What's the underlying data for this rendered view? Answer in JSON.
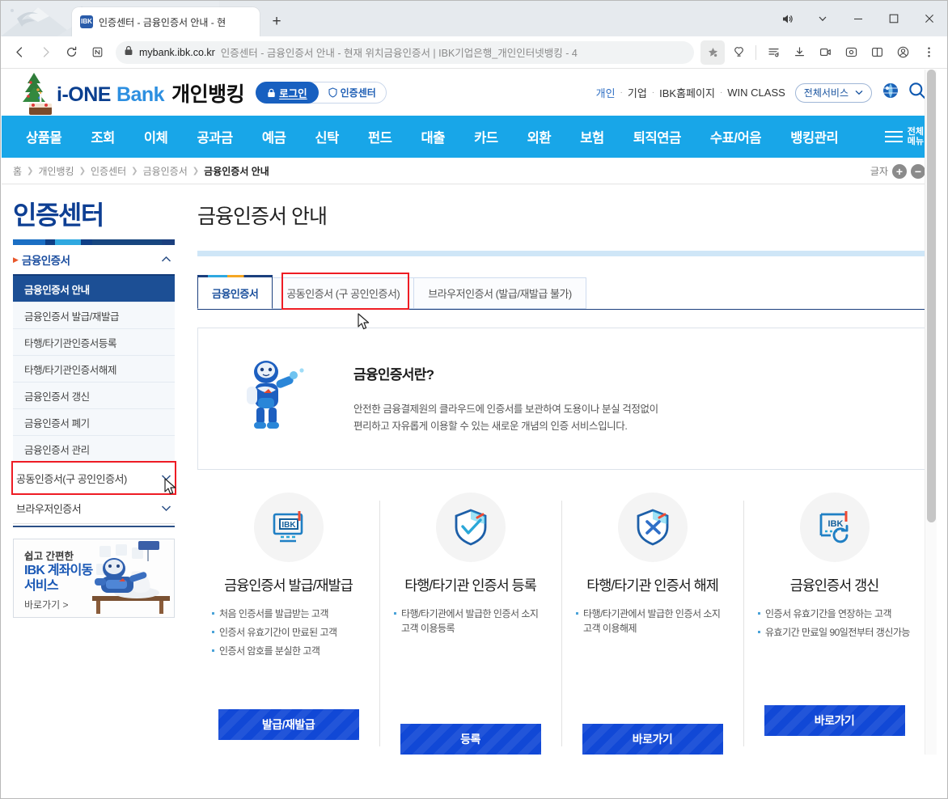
{
  "browser": {
    "tab": {
      "favicon": "ibk-favicon",
      "title": "인증센터 - 금융인증서 안내 - 현",
      "new_tab_label": "+"
    },
    "window_controls": {
      "mute_icon": "speaker-icon",
      "chevron_icon": "chevron-down-icon",
      "minimize": "minimize-icon",
      "maximize": "maximize-icon",
      "close": "close-icon"
    },
    "toolbar": {
      "back_icon": "back-arrow-icon",
      "forward_icon": "forward-arrow-icon",
      "reload_icon": "reload-icon",
      "split_icon": "n-box-icon",
      "lock_icon": "lock-icon",
      "url_domain": "mybank.ibk.co.kr",
      "url_rest": "인증센터 - 금융인증서 안내 - 현재 위치금융인증서 | IBK기업은행_개인인터넷뱅킹 - 4",
      "favorite_icon": "star-filled-icon",
      "collections_icon": "collections-icon",
      "vertical_tabs_icon": "vertical-tabs-icon",
      "downloads_icon": "downloads-icon",
      "screenshot_icon": "screen-capture-icon",
      "browser_essentials_icon": "browser-essentials-icon",
      "split_screen_icon": "split-screen-icon",
      "profile_icon": "profile-icon",
      "settings_icon": "more-options-icon"
    }
  },
  "site_header": {
    "brand": {
      "i": "i",
      "one": "-ONE",
      "bank": "Bank",
      "sub": "개인뱅킹"
    },
    "login_button": "로그인",
    "login_icon": "lock-icon",
    "cert_center_button": "인증센터",
    "cert_center_icon": "shield-icon",
    "links": [
      "개인",
      "기업",
      "IBK홈페이지",
      "WIN CLASS"
    ],
    "all_services": "전체서비스",
    "all_services_chevron": "chevron-down-icon",
    "globe_icon": "globe-icon",
    "search_icon": "search-icon"
  },
  "gnb": {
    "items": [
      "상품몰",
      "조회",
      "이체",
      "공과금",
      "예금",
      "신탁",
      "펀드",
      "대출",
      "카드",
      "외환",
      "보험",
      "퇴직연금",
      "수표/어음",
      "뱅킹관리"
    ],
    "all_menu_line1": "전체",
    "all_menu_line2": "메뉴",
    "hamburger_icon": "hamburger-icon"
  },
  "breadcrumb": {
    "items": [
      "홈",
      "개인뱅킹",
      "인증센터",
      "금융인증서"
    ],
    "current": "금융인증서 안내",
    "font_label": "글자",
    "font_increase": "+",
    "font_decrease": "−"
  },
  "sidebar": {
    "title": "인증센터",
    "group": {
      "label": "금융인증서",
      "chevron": "chevron-up-icon"
    },
    "items": [
      {
        "label": "금융인증서 안내",
        "active": true
      },
      {
        "label": "금융인증서 발급/재발급",
        "active": false
      },
      {
        "label": "타행/타기관인증서등록",
        "active": false
      },
      {
        "label": "타행/타기관인증서해제",
        "active": false
      },
      {
        "label": "금융인증서 갱신",
        "active": false
      },
      {
        "label": "금융인증서 폐기",
        "active": false
      },
      {
        "label": "금융인증서 관리",
        "active": false
      }
    ],
    "collapsed_groups": [
      {
        "label": "공동인증서(구 공인인증서)",
        "chevron": "chevron-down-icon",
        "highlighted": true
      },
      {
        "label": "브라우저인증서",
        "chevron": "chevron-down-icon",
        "highlighted": false
      }
    ],
    "banner": {
      "line1": "쉽고 간편한",
      "line2": "IBK 계좌이동",
      "line3": "서비스",
      "cta": "바로가기 >",
      "art": "ibk-robot-illustration"
    }
  },
  "main": {
    "page_title": "금융인증서 안내",
    "tabs": [
      {
        "label": "금융인증서",
        "active": true,
        "highlighted": false
      },
      {
        "label": "공동인증서 (구 공인인증서)",
        "active": false,
        "highlighted": true
      },
      {
        "label": "브라우저인증서 (발급/재발급 불가)",
        "active": false,
        "highlighted": false
      }
    ],
    "info_box": {
      "icon": "ibk-mascot-icon",
      "heading": "금융인증서란?",
      "body_line1": "안전한 금융결제원의 클라우드에 인증서를 보관하여 도용이나 분실 걱정없이",
      "body_line2": "편리하고 자유롭게 이용할 수 있는 새로운 개념의 인증 서비스입니다."
    },
    "cards": [
      {
        "icon": "ibk-monitor-icon",
        "title": "금융인증서 발급/재발급",
        "bullets": [
          "처음 인증서를 발급받는 고객",
          "인증서 유효기간이 만료된 고객",
          "인증서 암호를 분실한 고객"
        ],
        "button": "발급/재발급"
      },
      {
        "icon": "shield-check-icon",
        "title": "타행/타기관 인증서 등록",
        "bullets": [
          "타행/타기관에서 발급한 인증서 소지 고객 이용등록"
        ],
        "button": "등록"
      },
      {
        "icon": "shield-x-icon",
        "title": "타행/타기관 인증서 해제",
        "bullets": [
          "타행/타기관에서 발급한 인증서 소지 고객 이용해제"
        ],
        "button": "바로가기"
      },
      {
        "icon": "ibk-renew-icon",
        "title": "금융인증서 갱신",
        "bullets": [
          "인증서 유효기간을 연장하는 고객",
          "유효기간 만료일 90일전부터 갱신가능"
        ],
        "button": "바로가기"
      }
    ]
  },
  "colors": {
    "gnb_blue": "#18a6e8",
    "brand_navy": "#0b3f8f",
    "brand_sky": "#2d8fe0",
    "sidebar_active": "#1c4f95",
    "button_blue": "#1148d6",
    "highlight_red": "#ee1c24",
    "rule_light_blue": "#cfe6f7"
  }
}
